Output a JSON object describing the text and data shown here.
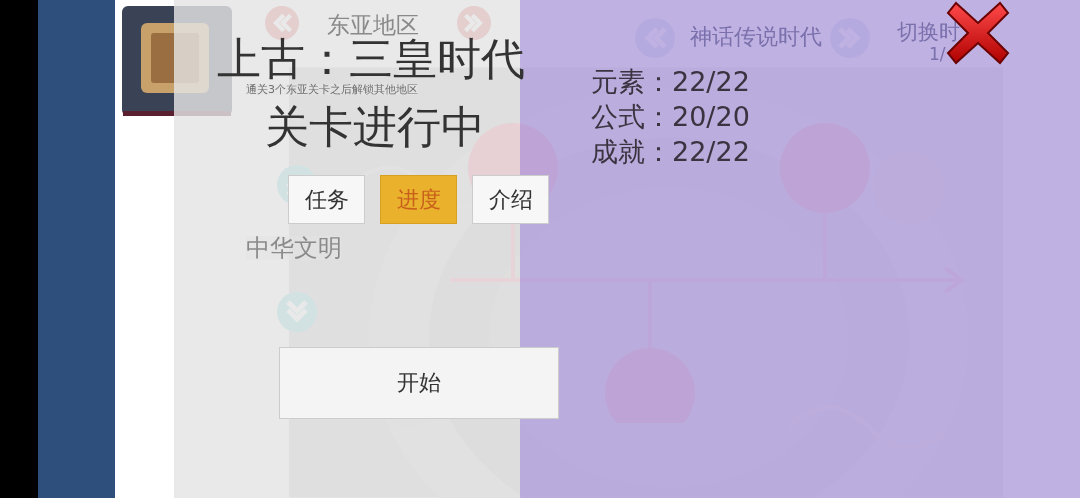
{
  "background": {
    "region_nav": {
      "label": "东亚地区"
    },
    "hint": "通关3个东亚关卡之后解锁其他地区",
    "era_nav": {
      "label": "神话传说时代"
    },
    "switch": {
      "label": "切换时",
      "page": "1/"
    },
    "civilization": "中华文明"
  },
  "dialog": {
    "title": "上古：三皇时代",
    "status": "关卡进行中",
    "stats": [
      "元素：22/22",
      "公式：20/20",
      "成就：22/22"
    ],
    "tabs": [
      {
        "label": "任务",
        "selected": false
      },
      {
        "label": "进度",
        "selected": true
      },
      {
        "label": "介绍",
        "selected": false
      }
    ],
    "start_button": "开始"
  }
}
